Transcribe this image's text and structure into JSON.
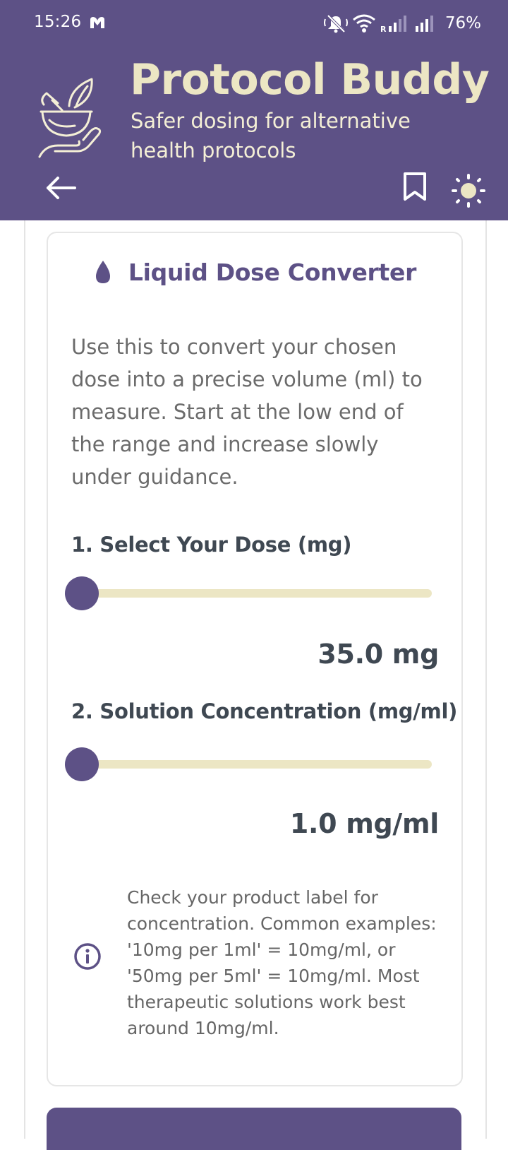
{
  "status_bar": {
    "time": "15:26",
    "battery": "76%",
    "icons": [
      "notification-icon",
      "mute-icon",
      "wifi-icon",
      "signal-icon",
      "signal-icon"
    ]
  },
  "header": {
    "title": "Protocol Buddy",
    "subtitle": "Safer dosing for alternative health protocols",
    "logo_icon": "mortar-pestle-hand-icon",
    "background_color": "#5d5186",
    "title_color": "#ece6c4"
  },
  "toolbar": {
    "back_icon": "back-arrow-icon",
    "bookmark_icon": "bookmark-icon",
    "theme_icon": "sun-icon"
  },
  "converter": {
    "title": "Liquid Dose Converter",
    "title_icon": "water-drop-icon",
    "intro": "Use this to convert your chosen dose  into a precise volume (ml) to measure. Start at the low end of the range and increase slowly under guidance.",
    "dose": {
      "label": "1. Select Your Dose (mg)",
      "value_text": "35.0 mg",
      "slider_fraction": 0
    },
    "concentration": {
      "label": "2. Solution Concentration (mg/ml)",
      "value_text": "1.0 mg/ml",
      "slider_fraction": 0
    },
    "info": {
      "icon": "info-icon",
      "text": "Check your product label for concentration. Common examples: '10mg per 1ml' = 10mg/ml, or '50mg per 5ml' = 10mg/ml. Most therapeutic solutions work best around 10mg/ml."
    }
  },
  "colors": {
    "accent": "#5d5186",
    "track": "#ece6c4",
    "heading_text": "#3f4852",
    "body_text": "#6b6b6b"
  }
}
